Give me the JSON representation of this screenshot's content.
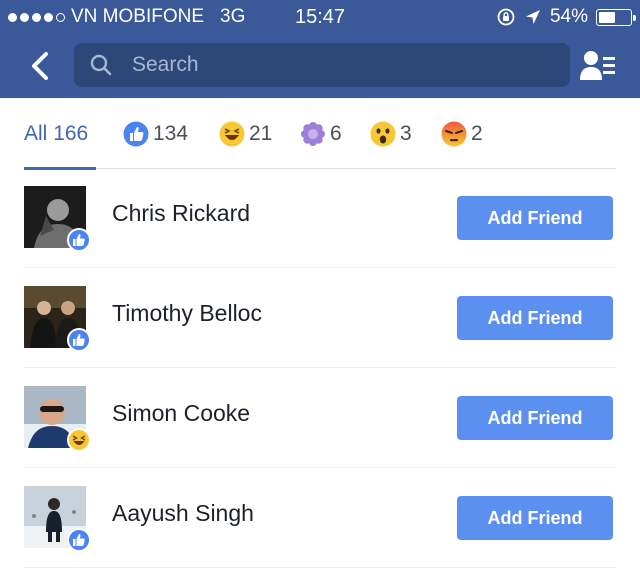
{
  "status_bar": {
    "carrier": "VN MOBIFONE",
    "network": "3G",
    "time": "15:47",
    "battery": "54%",
    "battery_level": 0.54
  },
  "nav": {
    "search_placeholder": "Search",
    "back_icon": "chevron-left-icon",
    "friends_icon": "friends-list-icon"
  },
  "tabs": [
    {
      "label": "All",
      "count": "166",
      "icon": null
    },
    {
      "label": "",
      "count": "134",
      "icon": "like-icon"
    },
    {
      "label": "",
      "count": "21",
      "icon": "haha-icon"
    },
    {
      "label": "",
      "count": "6",
      "icon": "thankful-flower-icon"
    },
    {
      "label": "",
      "count": "3",
      "icon": "wow-icon"
    },
    {
      "label": "",
      "count": "2",
      "icon": "angry-icon"
    }
  ],
  "people": [
    {
      "name": "Chris Rickard",
      "reaction": "like",
      "button": "Add Friend"
    },
    {
      "name": "Timothy Belloc",
      "reaction": "like",
      "button": "Add Friend"
    },
    {
      "name": "Simon Cooke",
      "reaction": "haha",
      "button": "Add Friend"
    },
    {
      "name": "Aayush Singh",
      "reaction": "like",
      "button": "Add Friend"
    }
  ],
  "colors": {
    "brand": "#3b5998",
    "accent": "#4267b2",
    "button": "#5b90f0"
  }
}
